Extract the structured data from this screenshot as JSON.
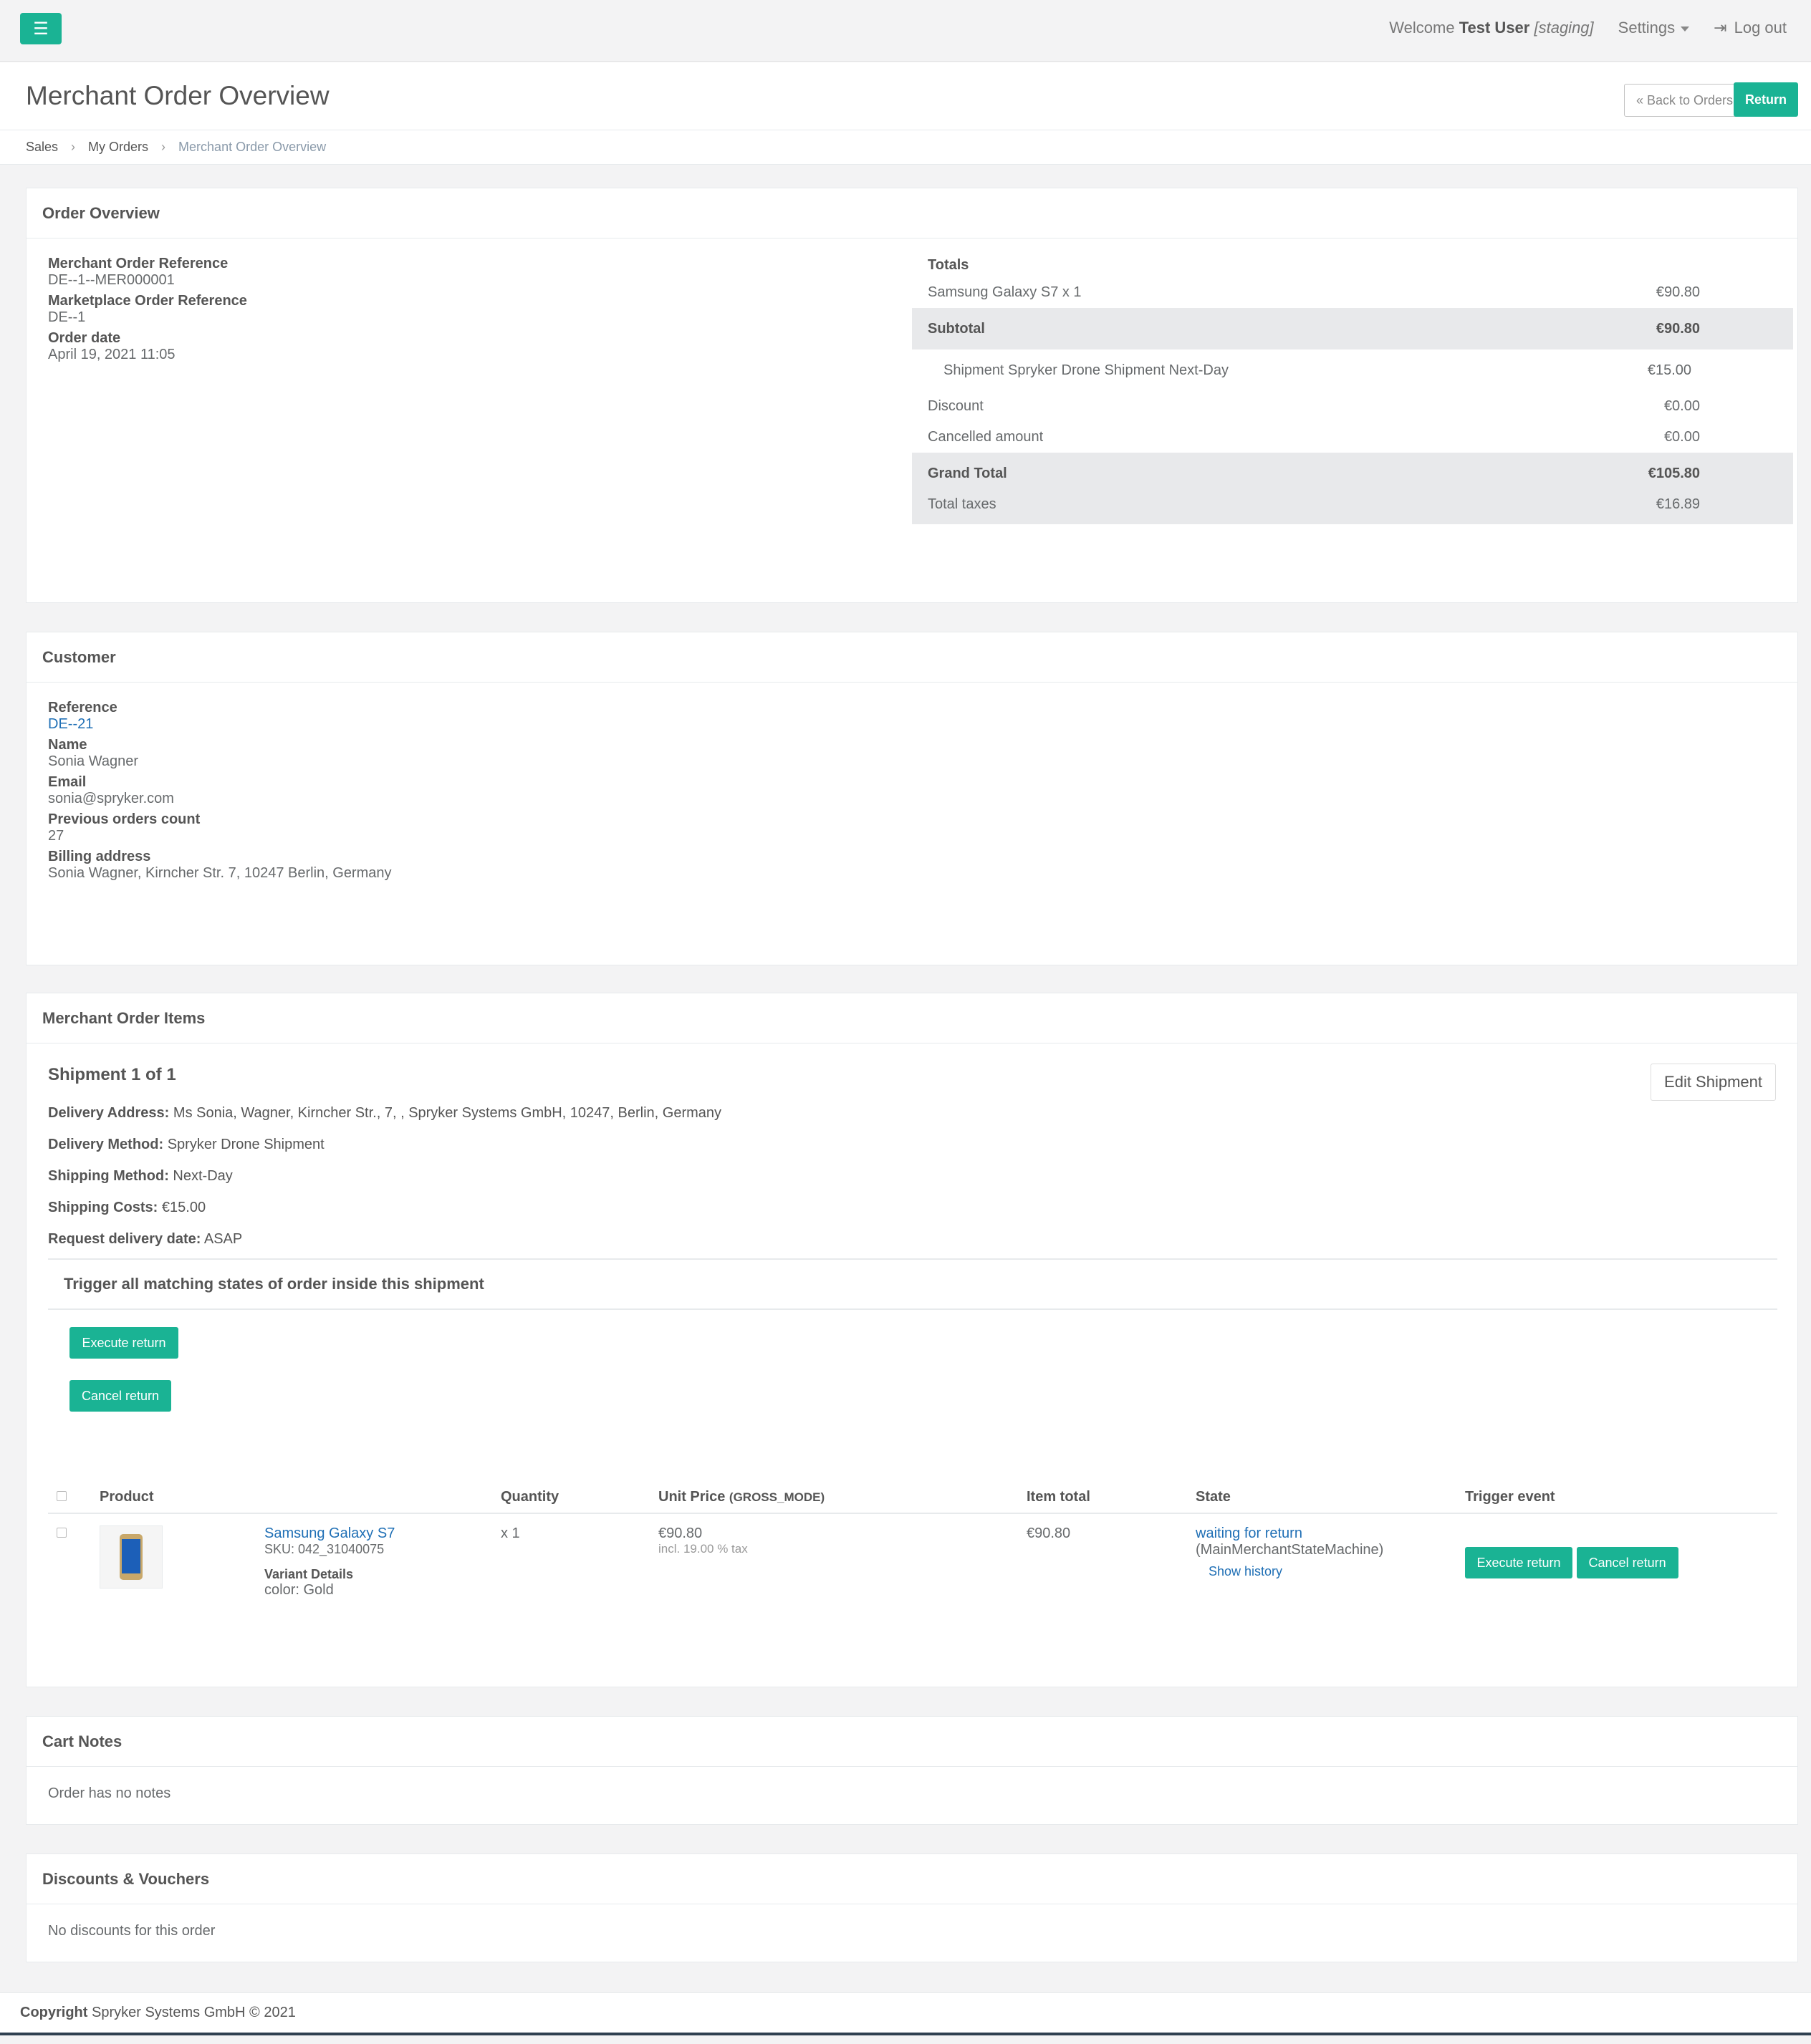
{
  "topbar": {
    "welcome_prefix": "Welcome",
    "user_name": "Test User",
    "env": "[staging]",
    "settings_label": "Settings",
    "logout_label": "Log out"
  },
  "heading": {
    "title": "Merchant Order Overview",
    "back_label": "« Back to Orders",
    "return_label": "Return"
  },
  "breadcrumb": [
    "Sales",
    "My Orders",
    "Merchant Order Overview"
  ],
  "order_overview": {
    "title": "Order Overview",
    "merchant_ref_label": "Merchant Order Reference",
    "merchant_ref": "DE--1--MER000001",
    "marketplace_ref_label": "Marketplace Order Reference",
    "marketplace_ref": "DE--1",
    "order_date_label": "Order date",
    "order_date": "April 19, 2021 11:05",
    "totals_label": "Totals",
    "item_line": "Samsung Galaxy S7 x 1",
    "item_line_value": "€90.80",
    "subtotal_label": "Subtotal",
    "subtotal": "€90.80",
    "shipment_label": "Shipment Spryker Drone Shipment Next-Day",
    "shipment_value": "€15.00",
    "discount_label": "Discount",
    "discount": "€0.00",
    "cancelled_label": "Cancelled amount",
    "cancelled": "€0.00",
    "grand_total_label": "Grand Total",
    "grand_total": "€105.80",
    "taxes_label": "Total taxes",
    "taxes": "€16.89"
  },
  "customer": {
    "title": "Customer",
    "reference_label": "Reference",
    "reference": "DE--21",
    "name_label": "Name",
    "name": "Sonia Wagner",
    "email_label": "Email",
    "email": "sonia@spryker.com",
    "prev_orders_label": "Previous orders count",
    "prev_orders": "27",
    "billing_label": "Billing address",
    "billing": "Sonia Wagner, Kirncher Str. 7, 10247 Berlin, Germany"
  },
  "items_panel": {
    "title": "Merchant Order Items",
    "shipment_title": "Shipment 1 of 1",
    "edit_shipment": "Edit Shipment",
    "delivery_address_label": "Delivery Address:",
    "delivery_address": "Ms Sonia, Wagner, Kirncher Str., 7, , Spryker Systems GmbH, 10247, Berlin, Germany",
    "delivery_method_label": "Delivery Method:",
    "delivery_method": "Spryker Drone Shipment",
    "shipping_method_label": "Shipping Method:",
    "shipping_method": "Next-Day",
    "shipping_costs_label": "Shipping Costs:",
    "shipping_costs": "€15.00",
    "request_date_label": "Request delivery date:",
    "request_date": "ASAP",
    "trigger_all_label": "Trigger all matching states of order inside this shipment",
    "execute_return": "Execute return",
    "cancel_return": "Cancel return",
    "columns": {
      "product": "Product",
      "quantity": "Quantity",
      "unit_price": "Unit Price",
      "unit_price_mode": "(GROSS_MODE)",
      "item_total": "Item total",
      "state": "State",
      "trigger_event": "Trigger event"
    },
    "row": {
      "name": "Samsung Galaxy S7",
      "sku": "SKU: 042_31040075",
      "variant_label": "Variant Details",
      "variant": "color: Gold",
      "quantity": "x 1",
      "unit_price": "€90.80",
      "tax_note": "incl. 19.00 % tax",
      "item_total": "€90.80",
      "state": "waiting for return",
      "state_machine": "(MainMerchantStateMachine)",
      "show_history": "Show history",
      "execute_return": "Execute return",
      "cancel_return": "Cancel return"
    }
  },
  "cart_notes": {
    "title": "Cart Notes",
    "text": "Order has no notes"
  },
  "discounts": {
    "title": "Discounts & Vouchers",
    "text": "No discounts for this order"
  },
  "footer": {
    "copyright_label": "Copyright",
    "copyright_text": "Spryker Systems GmbH © 2021"
  }
}
